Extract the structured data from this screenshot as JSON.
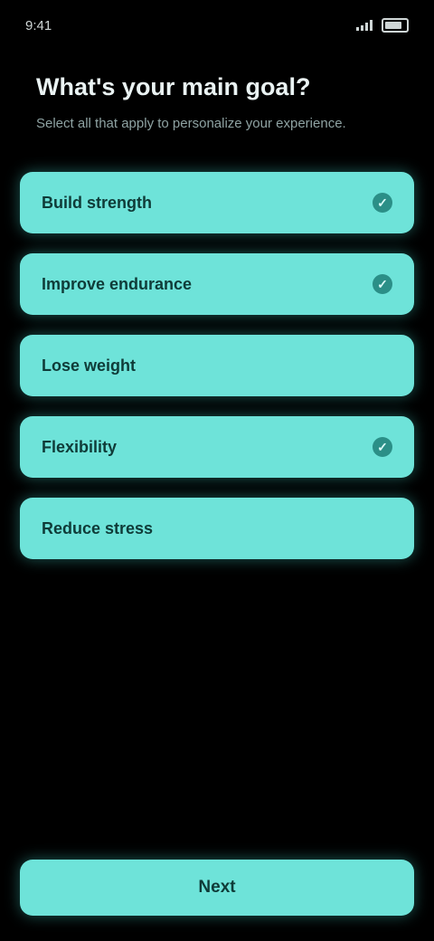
{
  "status_bar": {
    "time": "9:41"
  },
  "header": {
    "title": "What's your main goal?",
    "subtitle": "Select all that apply to personalize your experience."
  },
  "options": [
    {
      "label": "Build strength",
      "selected": true
    },
    {
      "label": "Improve endurance",
      "selected": true
    },
    {
      "label": "Lose weight",
      "selected": false
    },
    {
      "label": "Flexibility",
      "selected": true
    },
    {
      "label": "Reduce stress",
      "selected": false
    }
  ],
  "checkmark": "✓",
  "continue_label": "Next",
  "colors": {
    "background": "#000000",
    "accent": "#6ee3d9",
    "accent_dark": "#2b8f87"
  }
}
